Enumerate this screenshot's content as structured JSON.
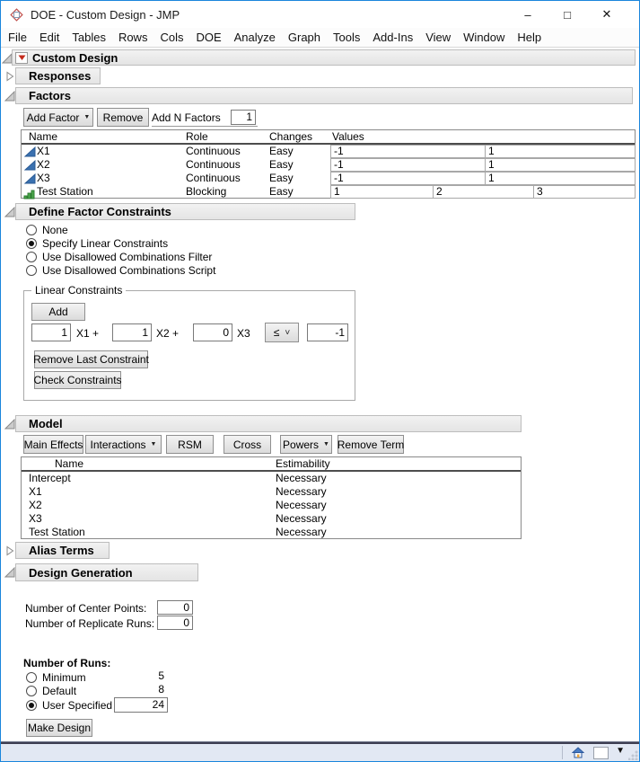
{
  "titlebar": {
    "title": "DOE - Custom Design - JMP",
    "minimize": "–",
    "maximize": "□",
    "close": "✕"
  },
  "menu": {
    "items": [
      "File",
      "Edit",
      "Tables",
      "Rows",
      "Cols",
      "DOE",
      "Analyze",
      "Graph",
      "Tools",
      "Add-Ins",
      "View",
      "Window",
      "Help"
    ]
  },
  "outline": {
    "custom_design": "Custom Design",
    "responses": "Responses",
    "factors": "Factors",
    "constraints": "Define Factor Constraints",
    "model": "Model",
    "alias_terms": "Alias Terms",
    "design_generation": "Design Generation"
  },
  "factors": {
    "add_factor": "Add Factor",
    "remove": "Remove",
    "add_n_label": "Add N Factors",
    "add_n_value": "1",
    "headers": [
      "Name",
      "Role",
      "Changes",
      "Values"
    ],
    "rows": [
      {
        "name": "X1",
        "role": "Continuous",
        "changes": "Easy",
        "values": [
          "-1",
          "1"
        ]
      },
      {
        "name": "X2",
        "role": "Continuous",
        "changes": "Easy",
        "values": [
          "-1",
          "1"
        ]
      },
      {
        "name": "X3",
        "role": "Continuous",
        "changes": "Easy",
        "values": [
          "-1",
          "1"
        ]
      },
      {
        "name": "Test Station",
        "role": "Blocking",
        "changes": "Easy",
        "values": [
          "1",
          "2",
          "3"
        ]
      }
    ]
  },
  "constraints": {
    "options": [
      "None",
      "Specify Linear Constraints",
      "Use Disallowed Combinations Filter",
      "Use Disallowed Combinations Script"
    ],
    "group_title": "Linear Constraints",
    "add": "Add",
    "coef1": "1",
    "term1": "X1 +",
    "coef2": "1",
    "term2": "X2 +",
    "coef3": "0",
    "term3": "X3",
    "operator": "≤",
    "bound": "-1",
    "remove_last": "Remove Last Constraint",
    "check": "Check Constraints"
  },
  "model": {
    "buttons": {
      "main_effects": "Main Effects",
      "interactions": "Interactions",
      "rsm": "RSM",
      "cross": "Cross",
      "powers": "Powers",
      "remove_term": "Remove Term"
    },
    "headers": [
      "Name",
      "Estimability"
    ],
    "rows": [
      {
        "name": "Intercept",
        "estimability": "Necessary"
      },
      {
        "name": "X1",
        "estimability": "Necessary"
      },
      {
        "name": "X2",
        "estimability": "Necessary"
      },
      {
        "name": "X3",
        "estimability": "Necessary"
      },
      {
        "name": "Test Station",
        "estimability": "Necessary"
      }
    ]
  },
  "design_generation": {
    "center_points_label": "Number of Center Points:",
    "center_points_value": "0",
    "replicate_runs_label": "Number of Replicate Runs:",
    "replicate_runs_value": "0",
    "runs_title": "Number of Runs:",
    "minimum_label": "Minimum",
    "minimum_value": "5",
    "default_label": "Default",
    "default_value": "8",
    "user_label": "User Specified",
    "user_value": "24",
    "make_design": "Make Design"
  }
}
